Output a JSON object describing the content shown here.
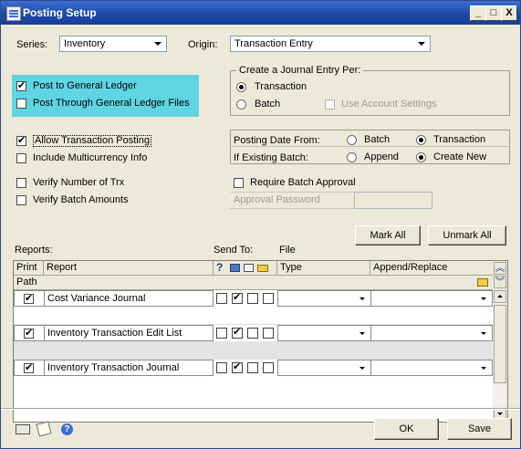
{
  "window": {
    "title": "Posting Setup"
  },
  "titlebar": {
    "minimize": "_",
    "restore": "□",
    "close": "X"
  },
  "series": {
    "label": "Series:",
    "value": "Inventory"
  },
  "origin": {
    "label": "Origin:",
    "value": "Transaction Entry"
  },
  "options": {
    "post_gl": "Post to General Ledger",
    "post_thru_gl": "Post Through General Ledger Files",
    "allow_posting": "Allow Transaction Posting",
    "multicurrency": "Include Multicurrency Info",
    "verify_trx": "Verify Number of Trx",
    "verify_amounts": "Verify Batch Amounts",
    "require_approval": "Require Batch Approval",
    "approval_password": "Approval Password"
  },
  "journal_entry": {
    "title": "Create a Journal Entry Per:",
    "transaction": "Transaction",
    "batch": "Batch",
    "use_account_settings": "Use Account Settings"
  },
  "posting_date": {
    "label": "Posting Date From:",
    "batch": "Batch",
    "transaction": "Transaction",
    "if_existing_label": "If Existing Batch:",
    "append": "Append",
    "create_new": "Create New"
  },
  "buttons": {
    "mark_all": "Mark All",
    "unmark_all": "Unmark All",
    "ok": "OK",
    "save": "Save"
  },
  "reports": {
    "label": "Reports:",
    "send_to": "Send To:",
    "file": "File",
    "columns": {
      "print": "Print",
      "report": "Report",
      "help": "?",
      "type": "Type",
      "append_replace": "Append/Replace",
      "path": "Path"
    },
    "rows": [
      {
        "print": true,
        "name": "Cost Variance Journal",
        "send": [
          false,
          true,
          false,
          false
        ]
      },
      {
        "print": true,
        "name": "Inventory Transaction Edit List",
        "send": [
          false,
          true,
          false,
          false
        ]
      },
      {
        "print": true,
        "name": "Inventory Transaction Journal",
        "send": [
          false,
          true,
          false,
          false
        ]
      }
    ]
  },
  "colors": {
    "highlight": "#5fd4e2",
    "titlebar": "#1d49a8",
    "window_bg": "#ece9d8"
  }
}
